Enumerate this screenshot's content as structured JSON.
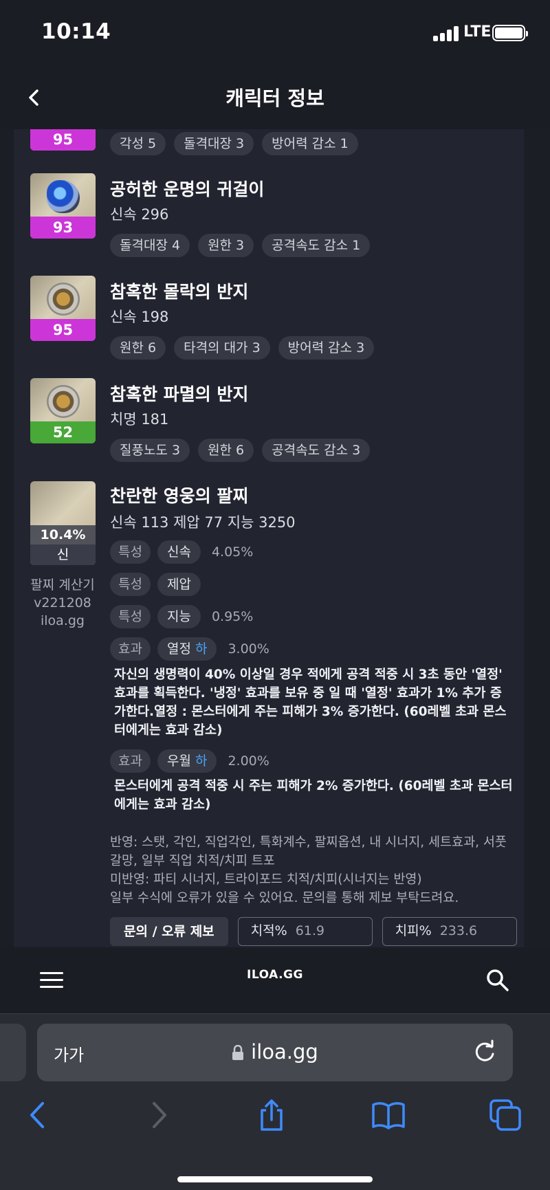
{
  "status_bar": {
    "time": "10:14",
    "network": "LTE"
  },
  "header": {
    "title": "캐릭터 정보"
  },
  "items": [
    {
      "name": "",
      "stat": "",
      "quality": "95",
      "tags": [
        "각성 5",
        "돌격대장 3",
        "방어력 감소 1"
      ]
    },
    {
      "name": "공허한 운명의 귀걸이",
      "stat": "신속 296",
      "quality": "93",
      "tags": [
        "돌격대장 4",
        "원한 3",
        "공격속도 감소 1"
      ]
    },
    {
      "name": "참혹한 몰락의 반지",
      "stat": "신속 198",
      "quality": "95",
      "tags": [
        "원한 6",
        "타격의 대가 3",
        "방어력 감소 3"
      ]
    },
    {
      "name": "참혹한 파멸의 반지",
      "stat": "치명 181",
      "quality": "52",
      "tags": [
        "질풍노도 3",
        "원한 6",
        "공격속도 감소 3"
      ]
    }
  ],
  "bracelet": {
    "name": "찬란한 영웅의 팔찌",
    "stats": "신속 113  제압 77  지능 3250",
    "percent": "10.4%",
    "grade": "신",
    "calc_label": [
      "팔찌 계산기",
      "v221208",
      "iloa.gg"
    ],
    "options": [
      {
        "type": "특성",
        "name": "신속",
        "grade": "",
        "value": "4.05%"
      },
      {
        "type": "특성",
        "name": "제압",
        "grade": "",
        "value": ""
      },
      {
        "type": "특성",
        "name": "지능",
        "grade": "",
        "value": "0.95%"
      },
      {
        "type": "효과",
        "name": "열정",
        "grade": "하",
        "value": "3.00%"
      },
      {
        "type": "효과",
        "name": "우월",
        "grade": "하",
        "value": "2.00%"
      }
    ],
    "effect_desc_1": "자신의 생명력이 40% 이상일 경우 적에게 공격 적중 시 3초 동안 '열정' 효과를 획득한다. '냉정' 효과를 보유 중 일 때 '열정' 효과가 1% 추가 증가한다.열정 : 몬스터에게 주는 피해가 3% 증가한다. (60레벨 초과 몬스터에게는 효과 감소)",
    "effect_desc_2": "몬스터에게 공격 적중 시 주는 피해가 2% 증가한다. (60레벨 초과 몬스터에게는 효과 감소)"
  },
  "notes": [
    "반영: 스탯, 각인, 직업각인, 특화계수, 팔찌옵션, 내 시너지, 세트효과, 서풋 갈망, 일부 직업 치적/치피 트포",
    "미반영: 파티 시너지, 트라이포드 치적/치피(시너지는 반영)",
    "일부 수식에 오류가 있을 수 있어요. 문의를 통해 제보 부탁드려요."
  ],
  "bottom": {
    "report_button": "문의 / 오류 제보",
    "crit_rate_label": "치적%",
    "crit_rate_value": "61.9",
    "crit_dmg_label": "치피%",
    "crit_dmg_value": "233.6"
  },
  "site_bar": {
    "logo": "ILOA.GG"
  },
  "safari": {
    "text_size": "가가",
    "url": "iloa.gg"
  },
  "colors": {
    "quality_purple": "#cc35d7",
    "quality_green": "#48a838",
    "grade_blue": "#4aa3ff",
    "accent_blue": "#3d8bff"
  },
  "icons": [
    "back-chevron-icon",
    "menu-icon",
    "search-icon",
    "lock-icon",
    "reload-icon",
    "back-arrow-icon",
    "forward-arrow-icon",
    "share-icon",
    "bookmarks-icon",
    "tabs-icon"
  ]
}
